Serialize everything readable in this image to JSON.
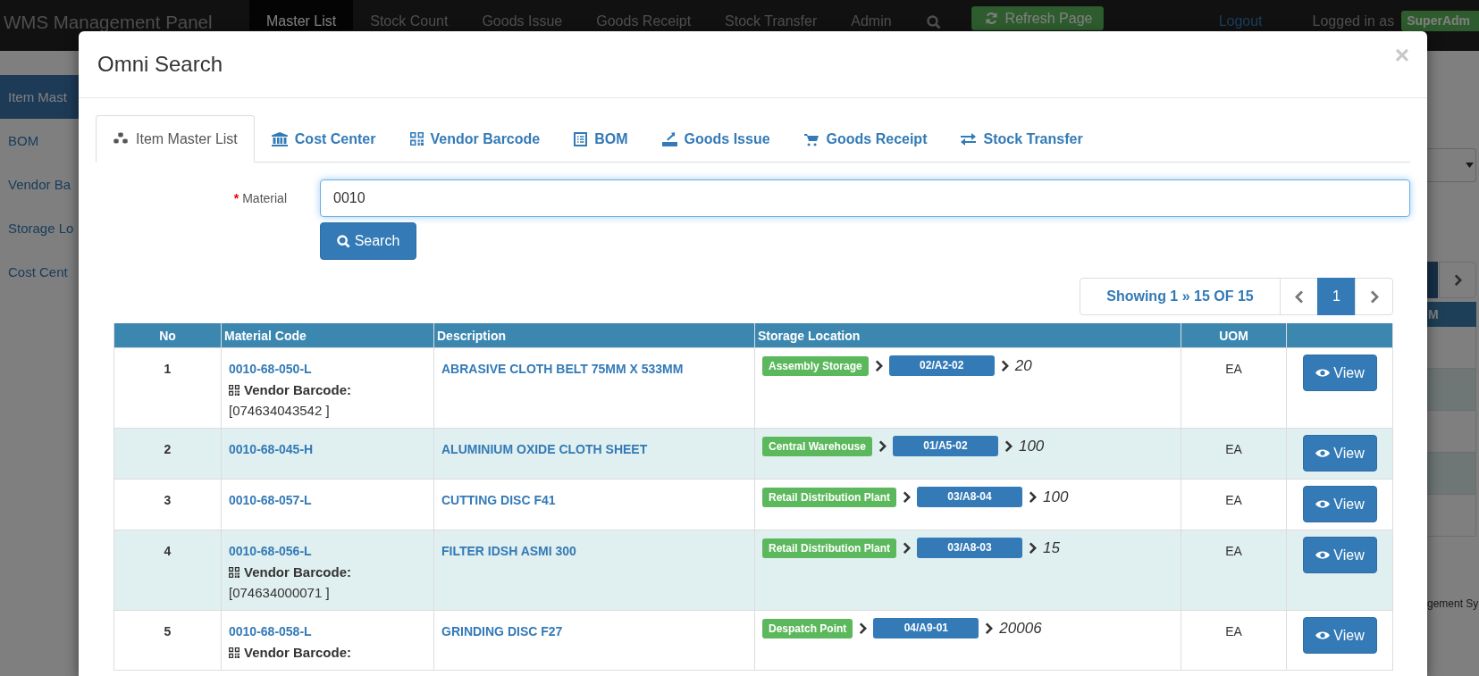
{
  "navbar": {
    "brand": "WMS Management Panel",
    "items": [
      {
        "label": "Master List",
        "selected": true
      },
      {
        "label": "Stock Count",
        "selected": false
      },
      {
        "label": "Goods Issue",
        "selected": false
      },
      {
        "label": "Goods Receipt",
        "selected": false
      },
      {
        "label": "Stock Transfer",
        "selected": false
      },
      {
        "label": "Admin",
        "selected": false
      }
    ],
    "refresh_button": "Refresh Page",
    "logout": "Logout",
    "logged_in_label": "Logged in as",
    "user_badge": "SuperAdm"
  },
  "sidebar": {
    "items": [
      {
        "label": "Item Mast",
        "selected": true
      },
      {
        "label": "BOM",
        "selected": false
      },
      {
        "label": "Vendor Ba",
        "selected": false
      },
      {
        "label": "Storage Lo",
        "selected": false
      },
      {
        "label": "Cost Cent",
        "selected": false
      }
    ]
  },
  "background": {
    "column_header": "M",
    "footer": "gement Sy"
  },
  "modal": {
    "title": "Omni Search",
    "close": "×",
    "tabs": [
      {
        "label": "Item Master List",
        "selected": true
      },
      {
        "label": "Cost Center",
        "selected": false
      },
      {
        "label": "Vendor Barcode",
        "selected": false
      },
      {
        "label": "BOM",
        "selected": false
      },
      {
        "label": "Goods Issue",
        "selected": false
      },
      {
        "label": "Goods Receipt",
        "selected": false
      },
      {
        "label": "Stock Transfer",
        "selected": false
      }
    ],
    "form": {
      "required_mark": "*",
      "label": "Material",
      "value": "0010",
      "search_button": "Search"
    },
    "pagination": {
      "summary": "Showing 1 » 15 OF 15",
      "pages": [
        {
          "label": "1",
          "selected": true
        }
      ]
    },
    "table": {
      "columns": [
        "No",
        "Material Code",
        "Description",
        "Storage Location",
        "UOM"
      ],
      "rows": [
        {
          "no": "1",
          "material_code": "0010-68-050-L",
          "vendor_barcode_label": "Vendor Barcode:",
          "vendor_barcode": "[074634043542 ]",
          "description": "ABRASIVE CLOTH BELT 75MM X 533MM",
          "location": "Assembly Storage",
          "bin": "02/A2-02",
          "quantity": "20",
          "uom": "EA",
          "action": "View"
        },
        {
          "no": "2",
          "material_code": "0010-68-045-H",
          "description": "ALUMINIUM OXIDE CLOTH SHEET",
          "location": "Central Warehouse",
          "bin": "01/A5-02",
          "quantity": "100",
          "uom": "EA",
          "action": "View"
        },
        {
          "no": "3",
          "material_code": "0010-68-057-L",
          "description": "CUTTING DISC F41",
          "location": "Retail Distribution Plant",
          "bin": "03/A8-04",
          "quantity": "100",
          "uom": "EA",
          "action": "View"
        },
        {
          "no": "4",
          "material_code": "0010-68-056-L",
          "vendor_barcode_label": "Vendor Barcode:",
          "vendor_barcode": "[074634000071 ]",
          "description": "FILTER IDSH ASMI 300",
          "location": "Retail Distribution Plant",
          "bin": "03/A8-03",
          "quantity": "15",
          "uom": "EA",
          "action": "View"
        },
        {
          "no": "5",
          "material_code": "0010-68-058-L",
          "vendor_barcode_label": "Vendor Barcode:",
          "description": "GRINDING DISC F27",
          "location": "Despatch Point",
          "bin": "04/A9-01",
          "quantity": "20006",
          "uom": "EA",
          "action": "View"
        }
      ]
    }
  }
}
